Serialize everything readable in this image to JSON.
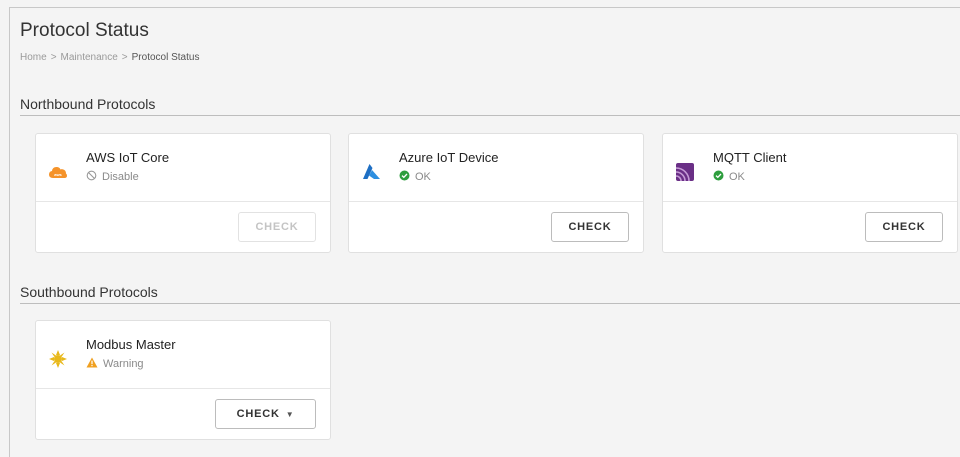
{
  "page": {
    "title": "Protocol Status",
    "breadcrumb": [
      "Home",
      "Maintenance",
      "Protocol Status"
    ],
    "breadcrumb_separator": ">"
  },
  "northbound": {
    "title": "Northbound Protocols",
    "cards": [
      {
        "name": "AWS IoT Core",
        "status": "Disable",
        "status_icon": "ban-icon",
        "button": "CHECK",
        "button_enabled": false,
        "icon": "aws-icon"
      },
      {
        "name": "Azure IoT Device",
        "status": "OK",
        "status_icon": "check-circle-icon",
        "button": "CHECK",
        "button_enabled": true,
        "icon": "azure-icon"
      },
      {
        "name": "MQTT Client",
        "status": "OK",
        "status_icon": "check-circle-icon",
        "button": "CHECK",
        "button_enabled": true,
        "icon": "mqtt-icon"
      }
    ]
  },
  "southbound": {
    "title": "Southbound Protocols",
    "cards": [
      {
        "name": "Modbus Master",
        "status": "Warning",
        "status_icon": "warning-icon",
        "button": "CHECK",
        "button_enabled": true,
        "button_dropdown": true,
        "icon": "modbus-icon"
      }
    ]
  },
  "colors": {
    "ok": "#2e9e3e",
    "warning": "#f0a020",
    "aws": "#f5932a",
    "azure": "#1e6fc4",
    "mqtt": "#6a2f86",
    "modbus": "#e8b81a"
  }
}
